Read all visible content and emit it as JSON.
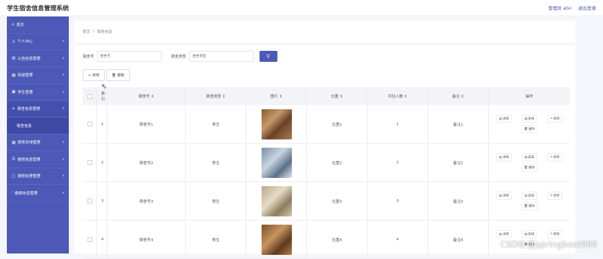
{
  "app": {
    "title": "学生宿舍信息管理系统",
    "user_label": "管理员 abo",
    "logout_label": "退出登录"
  },
  "sidebar": {
    "items": [
      {
        "label": "首页",
        "icon": "home-icon",
        "glyph": "⌂",
        "chevron": ""
      },
      {
        "label": "个人中心",
        "icon": "user-icon",
        "glyph": "♙",
        "chevron": "∨"
      },
      {
        "label": "公告信息管理",
        "icon": "notice-icon",
        "glyph": "▤",
        "chevron": "∨"
      },
      {
        "label": "班级管理",
        "icon": "class-icon",
        "glyph": "▦",
        "chevron": "∨"
      },
      {
        "label": "学生管理",
        "icon": "student-icon",
        "glyph": "▣",
        "chevron": "∨"
      },
      {
        "label": "宿舍信息管理",
        "icon": "dorm-icon",
        "glyph": "✈",
        "chevron": "∧"
      },
      {
        "label": "宿舍安排管理",
        "icon": "arrange-icon",
        "glyph": "▦",
        "chevron": "∨"
      },
      {
        "label": "报修信息管理",
        "icon": "repair-icon",
        "glyph": "☰",
        "chevron": "∨"
      },
      {
        "label": "报修处理管理",
        "icon": "process-icon",
        "glyph": "▢",
        "chevron": "∨"
      },
      {
        "label": "缴费信息管理",
        "icon": "payment-icon",
        "glyph": "⫶",
        "chevron": "∨"
      }
    ],
    "submenu_label": "宿舍信息"
  },
  "breadcrumb": {
    "home": "首页",
    "sep": "/",
    "current": "宿舍信息"
  },
  "search": {
    "room_label": "宿舍号",
    "room_placeholder": "宿舍号",
    "type_label": "宿舍类型",
    "type_placeholder": "宿舍类型",
    "button_glyph": "⚲"
  },
  "actions": {
    "add_label": "新增",
    "add_glyph": "+",
    "delete_label": "删除",
    "delete_glyph": "🗑"
  },
  "table": {
    "headers": [
      "索引",
      "宿舍号 ⇕",
      "宿舍类型 ⇕",
      "图片 ⇕",
      "位置 ⇕",
      "可住人数 ⇕",
      "备注 ⇕",
      "操作"
    ],
    "op_labels": {
      "detail": "详情",
      "arrange": "安排",
      "edit": "修改",
      "delete": "删除"
    },
    "op_glyphs": {
      "detail": "▤",
      "arrange": "▤",
      "edit": "✎",
      "delete": "🗑"
    },
    "rows": [
      {
        "index": "1",
        "room": "宿舍号1",
        "type": "男生",
        "location": "位置1",
        "capacity": "1",
        "note": "备注1"
      },
      {
        "index": "2",
        "room": "宿舍号2",
        "type": "男生",
        "location": "位置2",
        "capacity": "2",
        "note": "备注2"
      },
      {
        "index": "3",
        "room": "宿舍号3",
        "type": "男生",
        "location": "位置3",
        "capacity": "3",
        "note": "备注3"
      },
      {
        "index": "4",
        "room": "宿舍号4",
        "type": "男生",
        "location": "位置4",
        "capacity": "4",
        "note": "备注4"
      }
    ]
  },
  "watermark": "CSDN @springboot999",
  "colors": {
    "accent": "#4c59b6",
    "sidebar_bg": "#4c59b6",
    "page_bg": "#f5f6fb"
  }
}
